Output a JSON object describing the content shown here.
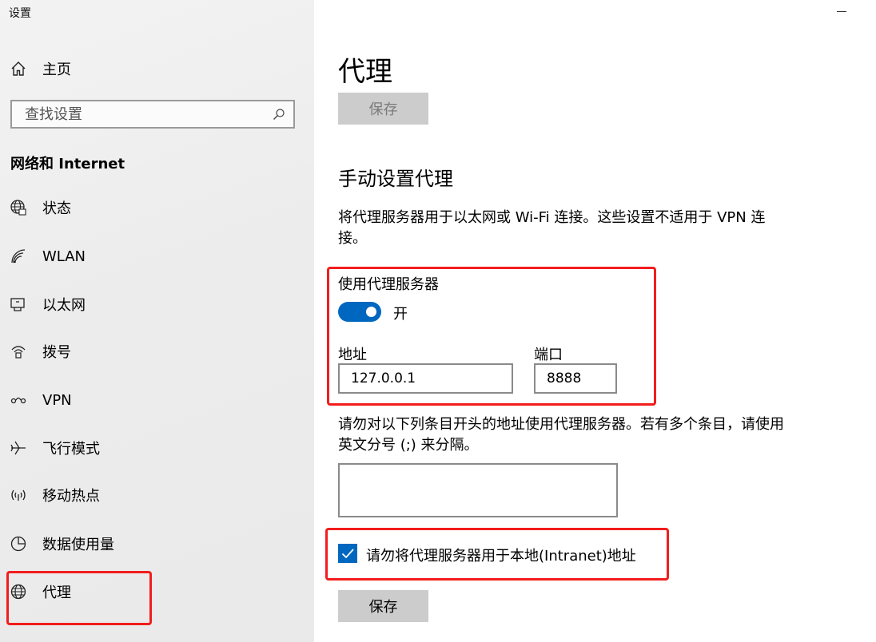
{
  "app_title": "设置",
  "colors": {
    "accent": "#0067c0",
    "annotation_red": "#f21d1d",
    "button_gray": "#cccccc"
  },
  "sidebar": {
    "home": {
      "label": "主页",
      "icon": "home-icon"
    },
    "search": {
      "placeholder": "查找设置",
      "icon": "search-icon"
    },
    "section_title": "网络和 Internet",
    "items": [
      {
        "label": "状态",
        "icon": "network-status-icon"
      },
      {
        "label": "WLAN",
        "icon": "wifi-icon"
      },
      {
        "label": "以太网",
        "icon": "ethernet-icon"
      },
      {
        "label": "拨号",
        "icon": "dialup-icon"
      },
      {
        "label": "VPN",
        "icon": "vpn-icon"
      },
      {
        "label": "飞行模式",
        "icon": "airplane-icon"
      },
      {
        "label": "移动热点",
        "icon": "hotspot-icon"
      },
      {
        "label": "数据使用量",
        "icon": "data-usage-icon"
      },
      {
        "label": "代理",
        "icon": "globe-icon",
        "selected": true
      }
    ]
  },
  "main": {
    "title": "代理",
    "top_save_label": "保存",
    "manual_heading": "手动设置代理",
    "manual_description": "将代理服务器用于以太网或 Wi-Fi 连接。这些设置不适用于 VPN 连接。",
    "use_proxy_label": "使用代理服务器",
    "use_proxy_state": "开",
    "use_proxy_on": true,
    "address_label": "地址",
    "address_value": "127.0.0.1",
    "port_label": "端口",
    "port_value": "8888",
    "exceptions_description": "请勿对以下列条目开头的地址使用代理服务器。若有多个条目，请使用英文分号 (;) 来分隔。",
    "exceptions_value": "",
    "bypass_local_label": "请勿将代理服务器用于本地(Intranet)地址",
    "bypass_local_checked": true,
    "bottom_save_label": "保存"
  }
}
